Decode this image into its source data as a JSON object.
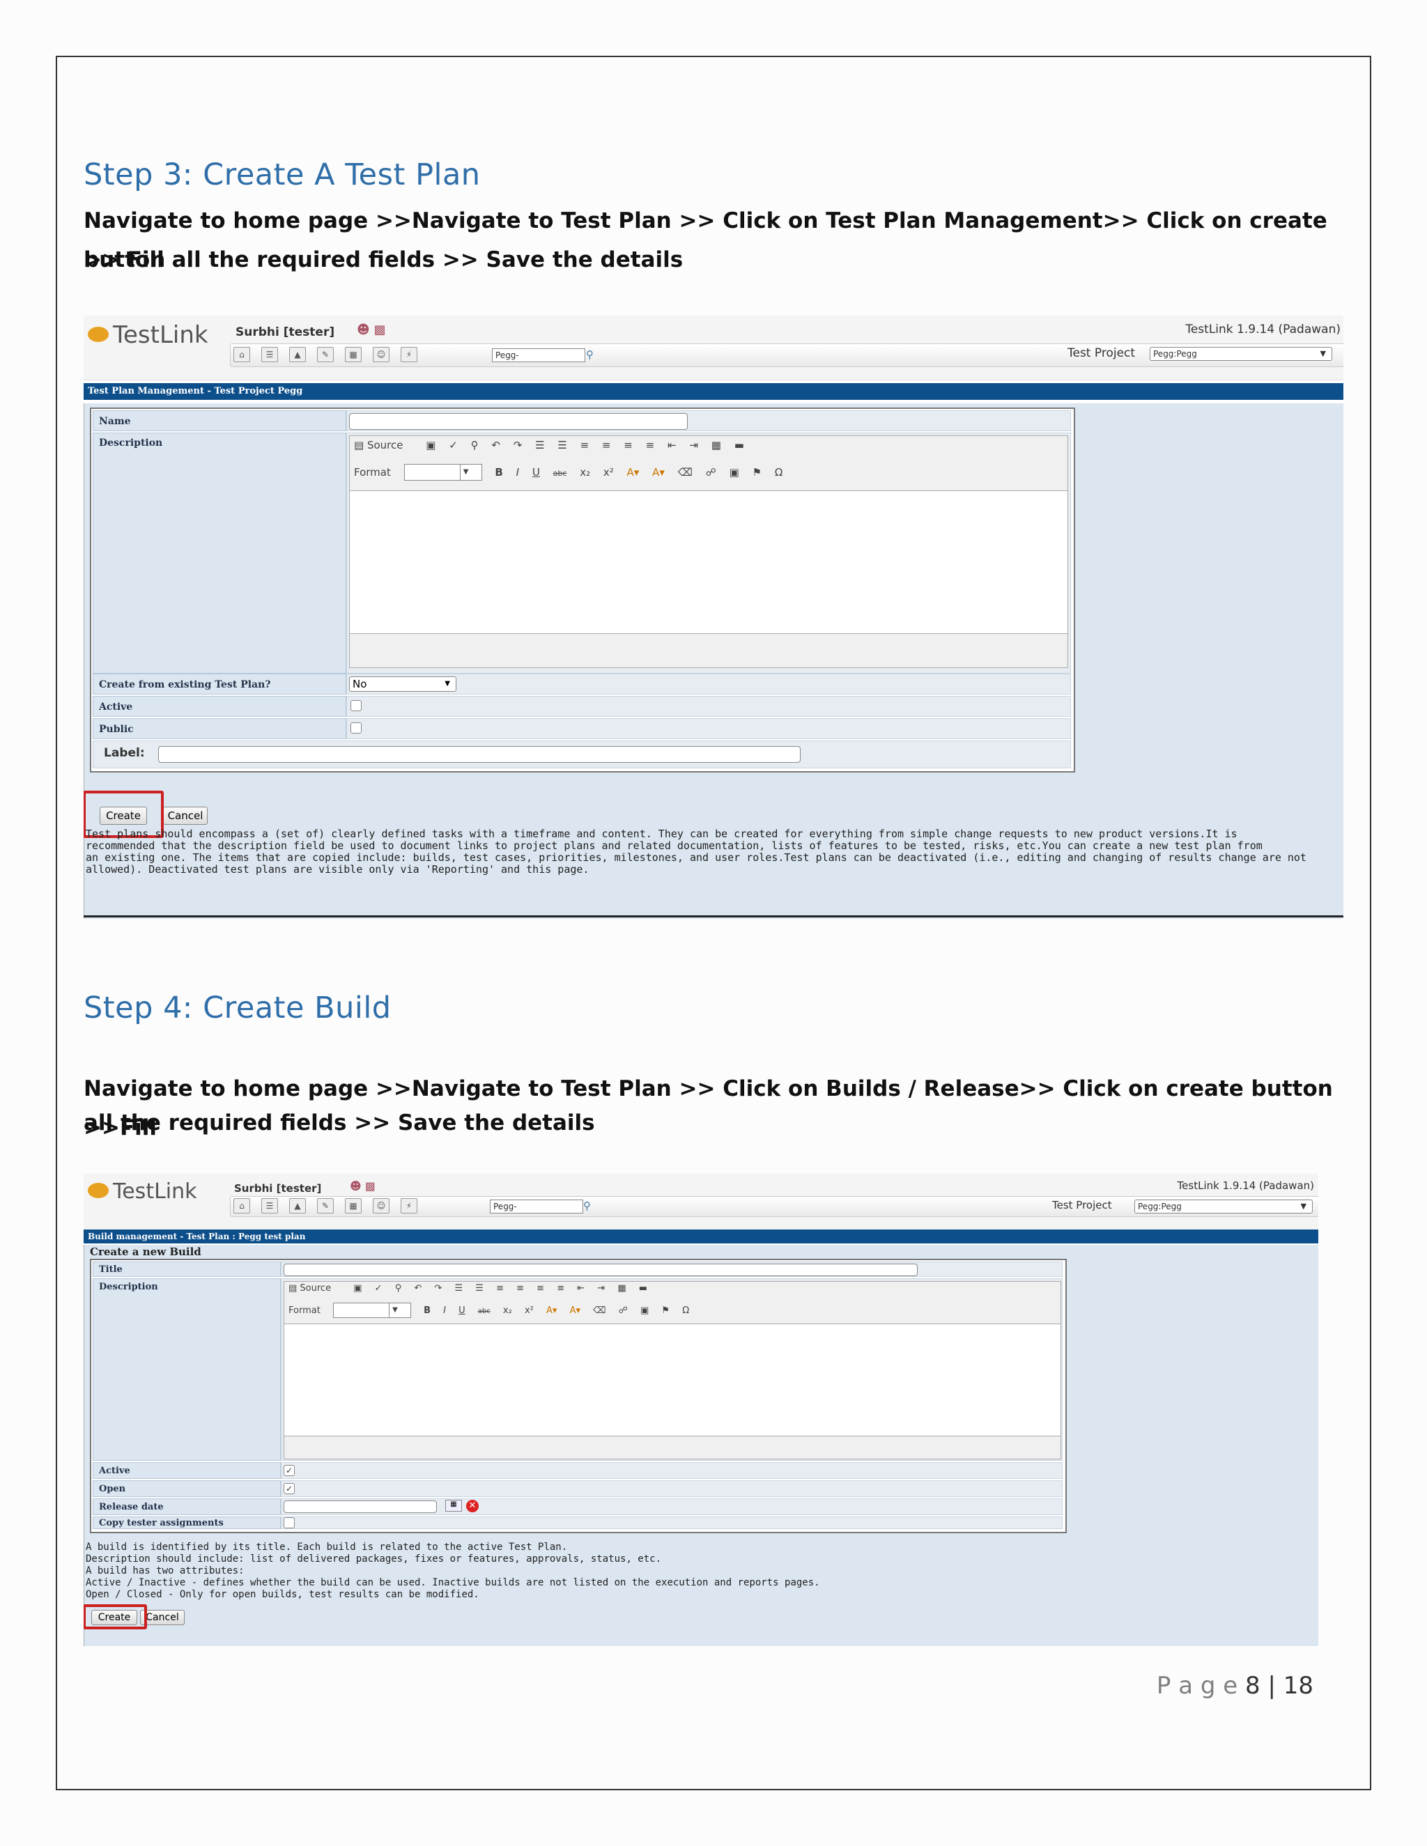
{
  "step3": {
    "heading": "Step 3: Create A Test Plan",
    "instructions_line1": "Navigate to home page >>Navigate to Test Plan >> Click on Test Plan Management>> Click on create button",
    "instructions_line2": ">> Fill all the required fields >> Save the details",
    "screenshot": {
      "logo": "TestLink",
      "user": "Surbhi [tester]",
      "search_value": "Pegg-",
      "version": "TestLink 1.9.14 (Padawan)",
      "project_label": "Test Project",
      "project_value": "Pegg:Pegg",
      "banner": "Test Plan Management - Test Project Pegg",
      "fields": {
        "name_label": "Name",
        "description_label": "Description",
        "create_from_label": "Create from existing Test Plan?",
        "create_from_value": "No",
        "active_label": "Active",
        "public_label": "Public",
        "label_label": "Label:"
      },
      "editor": {
        "source": "Source",
        "format": "Format"
      },
      "create_button": "Create",
      "cancel_button": "Cancel",
      "help_lines": [
        "Test plans should encompass a (set of) clearly defined tasks with a timeframe and content. They can be created for everything from simple change requests to new product versions.It is",
        "recommended that the description field be used to document links to project plans and related documentation, lists of features to be tested, risks, etc.You can create a new test plan from",
        "an existing one. The items that are copied include: builds, test cases, priorities, milestones, and user roles.Test plans can be deactivated (i.e., editing and changing of results change are not",
        "allowed). Deactivated test plans are visible only via 'Reporting' and this page."
      ]
    }
  },
  "step4": {
    "heading": "Step 4: Create Build",
    "instructions_line1": "Navigate to home page >>Navigate to Test Plan >> Click on Builds / Release>> Click on create button >>Fill",
    "instructions_line2": "all the required fields >> Save the details",
    "screenshot": {
      "logo": "TestLink",
      "user": "Surbhi [tester]",
      "search_value": "Pegg-",
      "version": "TestLink 1.9.14 (Padawan)",
      "project_label": "Test Project",
      "project_value": "Pegg:Pegg",
      "banner": "Build management - Test Plan : Pegg test plan",
      "section_title": "Create a new Build",
      "fields": {
        "title_label": "Title",
        "description_label": "Description",
        "active_label": "Active",
        "open_label": "Open",
        "release_date_label": "Release date",
        "copy_tester_label": "Copy tester assignments"
      },
      "editor": {
        "source": "Source",
        "format": "Format"
      },
      "active_checked": true,
      "open_checked": true,
      "copy_tester_checked": false,
      "create_button": "Create",
      "cancel_button": "Cancel",
      "help_lines": [
        "A build is identified by its title. Each build is related to the active Test Plan.",
        "Description should include: list of delivered packages, fixes or features, approvals, status, etc.",
        "A build has two attributes:",
        "Active / Inactive - defines whether the build can be used. Inactive builds are not listed on the execution and reports pages.",
        "Open / Closed - Only for open builds, test results can be modified."
      ]
    }
  },
  "footer": {
    "page_word": "P a g e",
    "page_number": "8",
    "separator": "|",
    "total_pages": "18"
  }
}
